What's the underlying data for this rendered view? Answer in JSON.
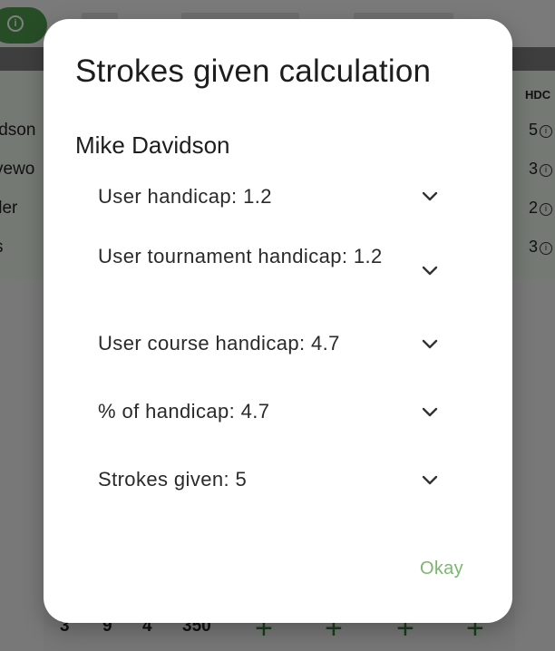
{
  "background": {
    "bottom_row_numbers": [
      "3",
      "9",
      "4",
      "350"
    ]
  },
  "dialog": {
    "title": "Strokes given calculation",
    "player_name": "Mike Davidson",
    "rows": [
      {
        "label": "User handicap: 1.2"
      },
      {
        "label": "User tournament handicap: 1.2"
      },
      {
        "label": "User course handicap: 4.7"
      },
      {
        "label": "% of handicap: 4.7"
      },
      {
        "label": "Strokes given: 5"
      }
    ],
    "okay_label": "Okay"
  },
  "colors": {
    "accent": "#7cb66e",
    "primary_green": "#4f9a4f",
    "dialog_bg": "#ffffff"
  },
  "icons": {
    "row_expand": "chevron-down-icon",
    "info": "info-icon"
  }
}
